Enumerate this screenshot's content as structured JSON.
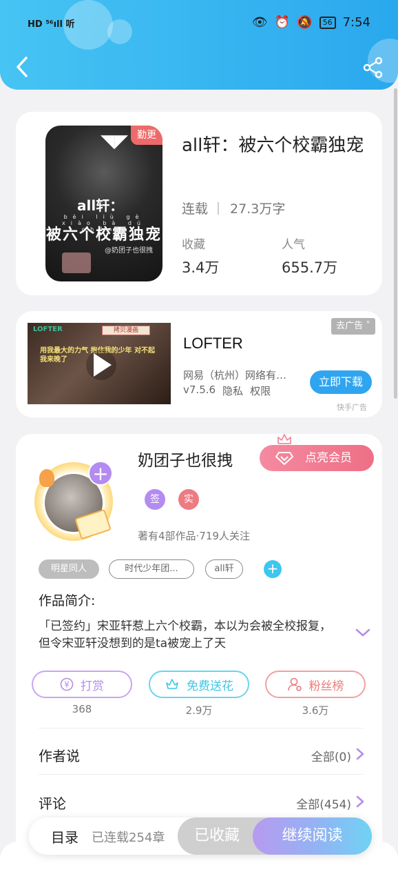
{
  "status_bar": {
    "left": "HD ⁵⁶ıll 听",
    "battery": "56",
    "time": "7:54"
  },
  "book": {
    "update_badge": "勤更",
    "title": "all轩：被六个校霸独宠",
    "status": "连载",
    "word_count": "27.3万字",
    "favorites_label": "收藏",
    "favorites_value": "3.4万",
    "popularity_label": "人气",
    "popularity_value": "655.7万",
    "cover": {
      "title_line1": "all轩：",
      "pinyin": "bèi liù gè xiào bà dú chǒng",
      "title_line2": "被六个校霸独宠",
      "author": "@奶团子也很拽"
    }
  },
  "ad": {
    "close_label": "去广告 ˅",
    "title": "LOFTER",
    "publisher": "网易（杭州）网络有限公司",
    "version": "v7.5.6",
    "privacy": "隐私",
    "permissions": "权限",
    "download_label": "立即下载",
    "source": "快手广告",
    "thumb": {
      "logo": "LOFTER",
      "strip": "拷贝漫画",
      "caption": "用我最大的力气 抱住我的少年 对不起 我来晚了"
    }
  },
  "author": {
    "name": "奶团子也很拽",
    "vip_label": "点亮会员",
    "badge_signed": "签",
    "badge_verified": "实",
    "stats": "著有4部作品·719人关注",
    "follow_label": "+"
  },
  "tags": [
    "明星同人",
    "时代少年团...",
    "all轩"
  ],
  "tag_add": "+",
  "intro": {
    "heading": "作品简介:",
    "text": "「已签约」宋亚轩惹上六个校霸，本以为会被全校报复，但令宋亚轩没想到的是ta被宠上了天"
  },
  "actions": [
    {
      "label": "打赏",
      "count": "368",
      "color": "#b68ce8",
      "icon": "yen-coin-icon"
    },
    {
      "label": "免费送花",
      "count": "2.9万",
      "color": "#3ec6e6",
      "icon": "flower-icon"
    },
    {
      "label": "粉丝榜",
      "count": "3.6万",
      "color": "#ee7a7a",
      "icon": "fans-icon"
    }
  ],
  "rows": {
    "author_says": {
      "title": "作者说",
      "value": "全部(0)"
    },
    "comments": {
      "title": "评论",
      "value": "全部(454)"
    }
  },
  "bottom_bar": {
    "toc_label": "目录",
    "chapter_count": "已连载254章",
    "collected_label": "已收藏",
    "read_label": "继续阅读"
  },
  "colors": {
    "header": "#2aa8ee",
    "accent_purple": "#b48bf0",
    "vip_pink": "#ee6f86",
    "download_blue": "#2fa5f0"
  }
}
